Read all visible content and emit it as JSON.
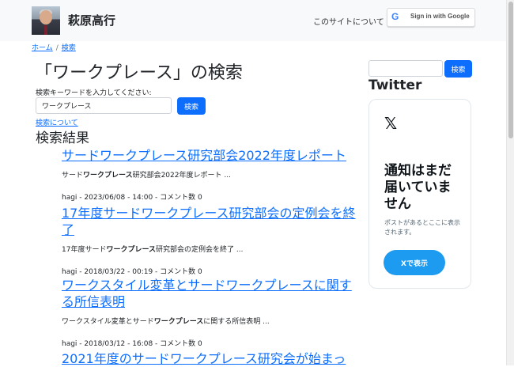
{
  "header": {
    "site_title": "萩原高行",
    "about_link": "このサイトについて",
    "google_g": "G",
    "google_signin": "Sign in with Google"
  },
  "breadcrumb": {
    "home": "ホーム",
    "separator": "/",
    "current": "検索"
  },
  "main": {
    "page_title": "「ワークプレース」の検索",
    "keyword_label": "検索キーワードを入力してください:",
    "keyword_value": "ワークプレース",
    "search_button": "検索",
    "about_search_link": "検索について",
    "results_heading": "検索結果",
    "results": [
      {
        "title": "サードワークプレース研究部会2022年度レポート",
        "excerpt_before": "サード",
        "excerpt_highlight": "ワークプレース",
        "excerpt_after": "研究部会2022年度レポート ...",
        "meta": "hagi - 2023/06/08 - 14:00 - コメント数 0"
      },
      {
        "title": "17年度サードワークプレース研究部会の定例会を終了",
        "excerpt_before": "17年度サード",
        "excerpt_highlight": "ワークプレース",
        "excerpt_after": "研究部会の定例会を終了 ...",
        "meta": "hagi - 2018/03/22 - 00:19 - コメント数 0"
      },
      {
        "title": "ワークスタイル変革とサードワークプレースに関する所信表明",
        "excerpt_before": "ワークスタイル変革とサード",
        "excerpt_highlight": "ワークプレース",
        "excerpt_after": "に関する所信表明 ...",
        "meta": "hagi - 2018/03/12 - 16:08 - コメント数 0"
      },
      {
        "title": "2021年度のサードワークプレース研究会が始まっ"
      }
    ]
  },
  "sidebar": {
    "search_button": "検索",
    "twitter_heading": "Twitter",
    "x_logo": "𝕏",
    "card_heading": "通知はまだ届いていません",
    "card_sub": "ポストがあるとここに表示されます。",
    "card_button": "Xで表示"
  }
}
